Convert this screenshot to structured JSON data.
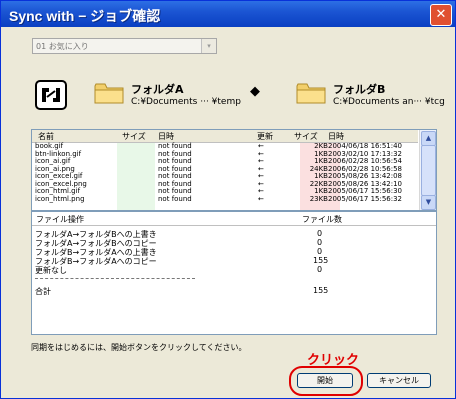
{
  "window": {
    "title": "Sync with − ジョブ確認",
    "close_glyph": "✕"
  },
  "profile_dropdown": {
    "value": "01 お気に入り",
    "arrow": "▾"
  },
  "folder_a": {
    "name": "フォルダA",
    "path": "C:¥Documents ··· ¥temp"
  },
  "folder_b": {
    "name": "フォルダB",
    "path": "C:¥Documents an··· ¥tcg"
  },
  "sync_arrow": "◆",
  "file_list": {
    "headers": {
      "name": "名前",
      "size_a": "サイズ",
      "date_a": "日時",
      "update": "更新",
      "size_b": "サイズ",
      "date_b": "日時"
    },
    "rows": [
      {
        "name": "book.gif",
        "size_a": "",
        "date_a": "not found",
        "update": "←",
        "size_b": "2KB",
        "date_b": "2004/06/18 16:51:40"
      },
      {
        "name": "btn-linkon.gif",
        "size_a": "",
        "date_a": "not found",
        "update": "←",
        "size_b": "1KB",
        "date_b": "2003/02/10 17:13:32"
      },
      {
        "name": "icon_ai.gif",
        "size_a": "",
        "date_a": "not found",
        "update": "←",
        "size_b": "1KB",
        "date_b": "2006/02/28 10:56:54"
      },
      {
        "name": "icon_ai.png",
        "size_a": "",
        "date_a": "not found",
        "update": "←",
        "size_b": "24KB",
        "date_b": "2006/02/28 10:56:58"
      },
      {
        "name": "icon_excel.gif",
        "size_a": "",
        "date_a": "not found",
        "update": "←",
        "size_b": "1KB",
        "date_b": "2005/08/26 13:42:08"
      },
      {
        "name": "icon_excel.png",
        "size_a": "",
        "date_a": "not found",
        "update": "←",
        "size_b": "22KB",
        "date_b": "2005/08/26 13:42:10"
      },
      {
        "name": "icon_html.gif",
        "size_a": "",
        "date_a": "not found",
        "update": "←",
        "size_b": "1KB",
        "date_b": "2005/06/17 15:56:30"
      },
      {
        "name": "icon_html.png",
        "size_a": "",
        "date_a": "not found",
        "update": "←",
        "size_b": "23KB",
        "date_b": "2005/06/17 15:56:32"
      }
    ],
    "scroll_up": "▲",
    "scroll_down": "▼"
  },
  "operations": {
    "headers": {
      "op": "ファイル操作",
      "count": "ファイル数"
    },
    "rows": [
      {
        "label": "フォルダA→フォルダBへの上書き",
        "count": "0"
      },
      {
        "label": "フォルダA→フォルダBへのコピー",
        "count": "0"
      },
      {
        "label": "フォルダB→フォルダAへの上書き",
        "count": "0"
      },
      {
        "label": "フォルダB→フォルダAへのコピー",
        "count": "155"
      },
      {
        "label": "更新なし",
        "count": "0"
      }
    ],
    "total_label": "合計",
    "total_count": "155"
  },
  "instruction": "同期をはじめるには、開始ボタンをクリックしてください。",
  "annotation": "クリック",
  "buttons": {
    "start": "開始",
    "cancel": "キャンセル"
  },
  "colors": {
    "titlebar": "#0a3fc2",
    "annotation": "#e00000",
    "highlight": "#e00000"
  }
}
